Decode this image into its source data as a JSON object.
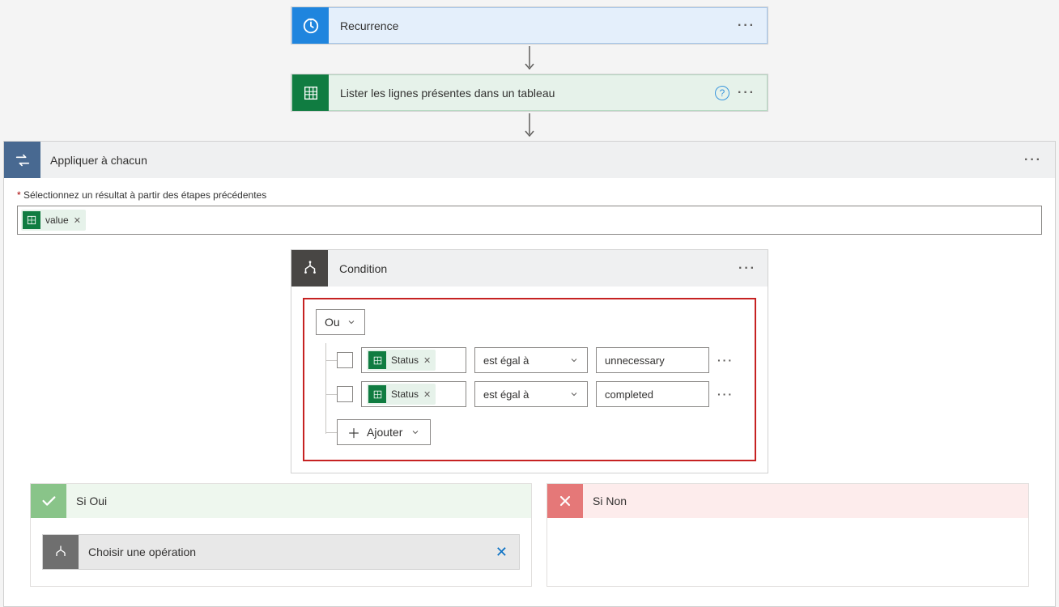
{
  "recurrence": {
    "title": "Recurrence"
  },
  "excel_list": {
    "title": "Lister les lignes présentes dans un tableau"
  },
  "apply_each": {
    "title": "Appliquer à chacun",
    "input_label": "Sélectionnez un résultat à partir des étapes précédentes",
    "token_label": "value"
  },
  "condition": {
    "title": "Condition",
    "logic_label": "Ou",
    "rows": [
      {
        "field": "Status",
        "operator": "est égal à",
        "value": "unnecessary"
      },
      {
        "field": "Status",
        "operator": "est égal à",
        "value": "completed"
      }
    ],
    "add_label": "Ajouter"
  },
  "branch_yes": {
    "title": "Si Oui"
  },
  "branch_no": {
    "title": "Si Non"
  },
  "choose_op": {
    "title": "Choisir une opération"
  }
}
